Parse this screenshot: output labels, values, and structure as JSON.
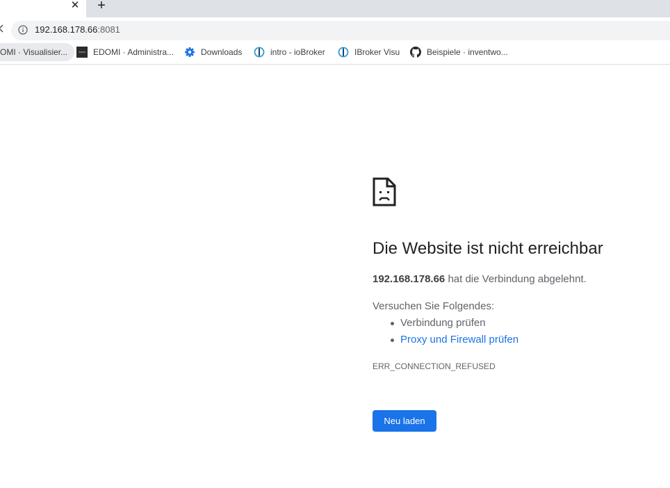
{
  "browser": {
    "new_tab_symbol": "+",
    "close_symbol": "✕",
    "address": {
      "host": "192.168.178.66",
      "port": ":8081"
    },
    "bookmarks": [
      {
        "label": "OMI · Visualisier...",
        "icon": "edomi-favicon"
      },
      {
        "label": "EDOMI · Administra...",
        "icon": "edomi-favicon"
      },
      {
        "label": "Downloads",
        "icon": "gear-icon"
      },
      {
        "label": "intro - ioBroker",
        "icon": "iobroker-icon"
      },
      {
        "label": "IBroker Visu",
        "icon": "iobroker-icon"
      },
      {
        "label": "Beispiele · inventwo...",
        "icon": "github-icon"
      }
    ]
  },
  "error_page": {
    "title": "Die Website ist nicht erreichbar",
    "host": "192.168.178.66",
    "summary_rest": " hat die Verbindung abgelehnt.",
    "suggestions_heading": "Versuchen Sie Folgendes:",
    "suggestions": [
      {
        "label": "Verbindung prüfen"
      },
      {
        "label": "Proxy und Firewall prüfen"
      }
    ],
    "error_code": "ERR_CONNECTION_REFUSED",
    "reload_label": "Neu laden"
  },
  "colors": {
    "accent": "#1a73e8",
    "tabstrip": "#dee1e6",
    "omnibox": "#f1f3f4"
  }
}
